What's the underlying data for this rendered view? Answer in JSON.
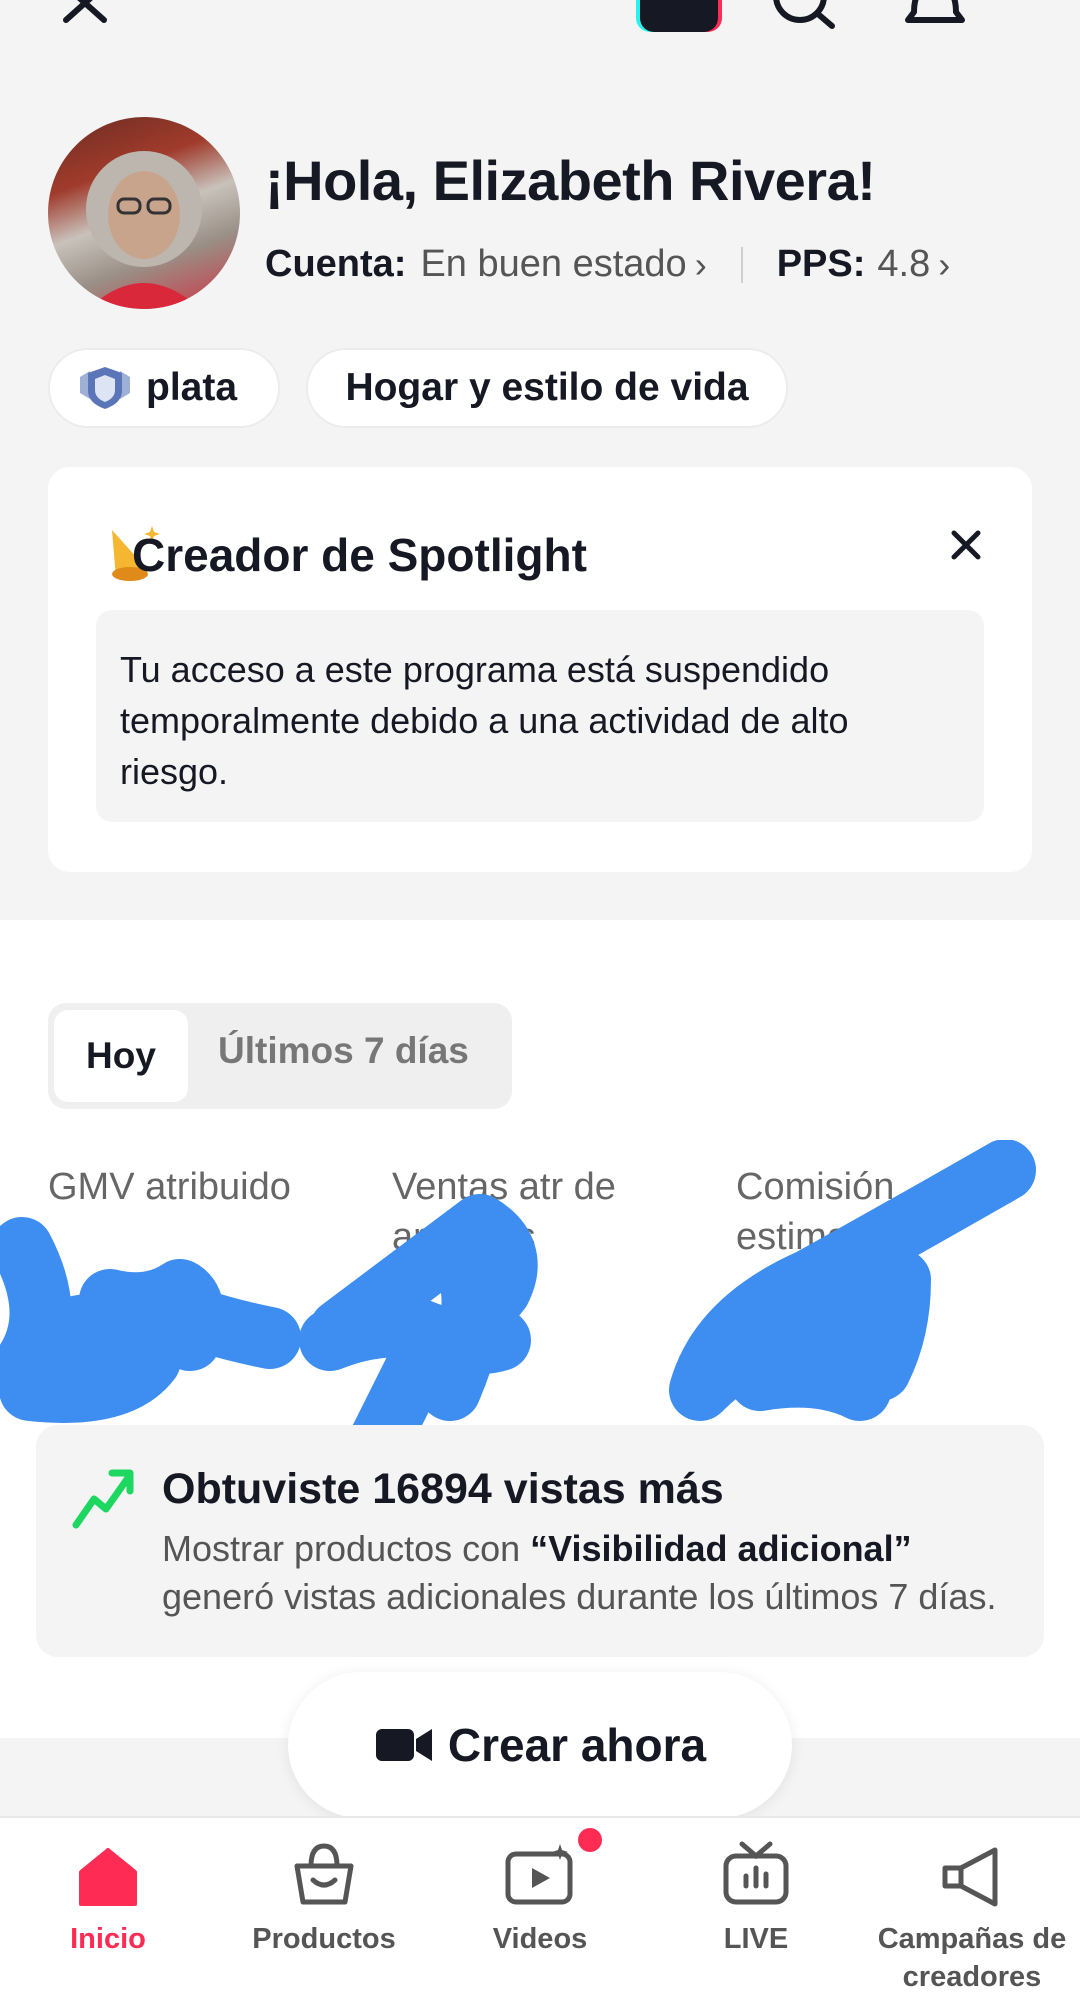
{
  "header": {
    "icons": [
      "close-icon",
      "app-icon",
      "search-icon",
      "bell-icon"
    ]
  },
  "profile": {
    "greeting": "¡Hola, Elizabeth Rivera!",
    "account_label": "Cuenta:",
    "account_status": "En buen estado",
    "pps_label": "PPS:",
    "pps_value": "4.8"
  },
  "tags": {
    "tier": "plata",
    "category": "Hogar y estilo de vida"
  },
  "spotlight": {
    "title": "Creador de Spotlight",
    "message": "Tu acceso a este programa está suspendido temporalmente debido a una actividad de alto riesgo."
  },
  "period_tabs": {
    "active": "Hoy",
    "other": "Últimos 7 días"
  },
  "metrics": {
    "labels": [
      "GMV atribuido",
      "Ventas atr de artículos",
      "Comisión estimada"
    ]
  },
  "insight": {
    "title": "Obtuviste 16894 vistas más",
    "body_prefix": "Mostrar productos con ",
    "body_highlight": "“Visibilidad adicional”",
    "body_suffix": " generó vistas adicionales durante los últimos 7 días."
  },
  "create_button": {
    "label": "Crear ahora"
  },
  "bottom_nav": [
    {
      "label": "Inicio",
      "icon": "home-icon",
      "active": true
    },
    {
      "label": "Productos",
      "icon": "shopping-bag-icon",
      "active": false
    },
    {
      "label": "Videos",
      "icon": "video-icon",
      "active": false
    },
    {
      "label": "LIVE",
      "icon": "live-tv-icon",
      "active": false
    },
    {
      "label": "Campañas de creadores",
      "icon": "megaphone-icon",
      "active": false
    }
  ],
  "colors": {
    "accent": "#fe2c55",
    "trend": "#1ed760",
    "scribble": "#3d8ef0"
  }
}
